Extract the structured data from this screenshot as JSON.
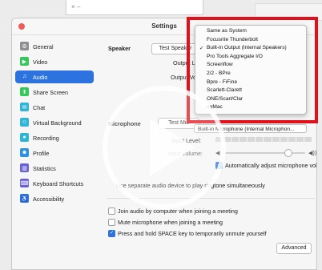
{
  "bg": {
    "tab_close": "×  –"
  },
  "window": {
    "title": "Settings"
  },
  "sidebar": {
    "items": [
      {
        "label": "General",
        "icon": "gear-icon",
        "color": "#8e8e93",
        "glyph": "⚙"
      },
      {
        "label": "Video",
        "icon": "video-icon",
        "color": "#34c759",
        "glyph": "▶"
      },
      {
        "label": "Audio",
        "icon": "headphones-icon",
        "color": "#2d73e0",
        "glyph": "♫",
        "active": true
      },
      {
        "label": "Share Screen",
        "icon": "share-screen-icon",
        "color": "#34c759",
        "glyph": "⬆"
      },
      {
        "label": "Chat",
        "icon": "chat-icon",
        "color": "#2fb5d6",
        "glyph": "✉"
      },
      {
        "label": "Virtual Background",
        "icon": "background-icon",
        "color": "#2fb5d6",
        "glyph": "☺"
      },
      {
        "label": "Recording",
        "icon": "recording-icon",
        "color": "#2fb5d6",
        "glyph": "●"
      },
      {
        "label": "Profile",
        "icon": "profile-icon",
        "color": "#2d90e0",
        "glyph": "☻"
      },
      {
        "label": "Statistics",
        "icon": "statistics-icon",
        "color": "#6b5fd6",
        "glyph": "▥"
      },
      {
        "label": "Keyboard Shortcuts",
        "icon": "keyboard-icon",
        "color": "#6b5fd6",
        "glyph": "⌨"
      },
      {
        "label": "Accessibility",
        "icon": "accessibility-icon",
        "color": "#2d73e0",
        "glyph": "♿"
      }
    ]
  },
  "audio": {
    "speaker_label": "Speaker",
    "test_speaker": "Test Speaker",
    "output_level_label": "Output Level:",
    "output_volume_label": "Output Volume:",
    "microphone_label": "Microphone",
    "test_mic": "Test Mic",
    "mic_device": "Built-in Microphone (Internal Microphon...",
    "input_level_label": "Input Level:",
    "input_volume_label": "Input Volume:",
    "input_volume_level": 0.78,
    "auto_adjust": "Automatically adjust microphone volume",
    "auto_adjust_checked": true,
    "separate_device": "Use separate audio device to play ringtone simultaneously",
    "join_auto": "Join audio by computer when joining a meeting",
    "mute_on_join": "Mute microphone when joining a meeting",
    "space_unmute": "Press and hold SPACE key to temporarily unmute yourself",
    "space_unmute_checked": true,
    "advanced": "Advanced"
  },
  "dropdown": {
    "items": [
      {
        "label": "Same as System",
        "checked": false
      },
      {
        "label": "Focusrite Thunderbolt",
        "checked": false
      },
      {
        "label": "Built-in Output (Internal Speakers)",
        "checked": true
      },
      {
        "label": "Pro Tools Aggregate I/O",
        "checked": false
      },
      {
        "label": "Screenflow",
        "checked": false
      },
      {
        "label": "2/2 - BPre",
        "checked": false
      },
      {
        "label": "Bpre - FiFine",
        "checked": false
      },
      {
        "label": "Scarlett-Clarett",
        "checked": false
      },
      {
        "label": "ONE/Scarl/Clar",
        "checked": false
      },
      {
        "label": "eqMac",
        "checked": false
      }
    ],
    "check_glyph": "✓"
  },
  "colors": {
    "accent": "#2d73e0",
    "highlight_box": "#e3101b"
  }
}
